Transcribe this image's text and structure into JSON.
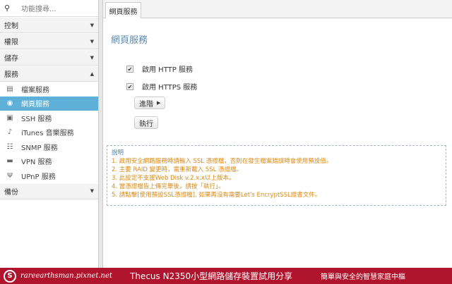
{
  "sidebar": {
    "search_placeholder": "功能搜尋...",
    "sections": [
      {
        "label": "控制"
      },
      {
        "label": "權限"
      },
      {
        "label": "儲存"
      },
      {
        "label": "服務"
      },
      {
        "label": "備份"
      }
    ],
    "items": [
      {
        "label": "檔案服務",
        "icon": "folder-icon"
      },
      {
        "label": "網頁服務",
        "icon": "globe-icon"
      },
      {
        "label": "SSH 服務",
        "icon": "terminal-icon"
      },
      {
        "label": "iTunes 音樂服務",
        "icon": "music-icon"
      },
      {
        "label": "SNMP 服務",
        "icon": "network-icon"
      },
      {
        "label": "VPN 服務",
        "icon": "vpn-icon"
      },
      {
        "label": "UPnP 服務",
        "icon": "antenna-icon"
      }
    ]
  },
  "main": {
    "tab": "網頁服務",
    "title": "網頁服務",
    "http_label": "啟用 HTTP 服務",
    "http_checked": true,
    "https_label": "啟用 HTTPS 服務",
    "https_checked": true,
    "advanced_label": "進階",
    "apply_label": "執行",
    "info": {
      "heading": "說明",
      "lines": [
        "1. 啟用安全網路服務時請輸入 SSL 憑證檔，否則在發生檔案錯誤時會使用預設值。",
        "2. 主要 RAID 變更時，需重新載入 SSL 憑證檔。",
        "3. 此設定不支援Web Disk v.2.x.x以上版本。",
        "4. 當憑證檔皆上傳完畢後，請按「執行」。",
        "5. 請點擊[使用預設SSL憑證檔], 如果再沒有需要Let's EncryptSSL證書文件。"
      ]
    }
  },
  "banner": {
    "site": "rareearthsman.pixnet.net",
    "title": "Thecus N2350小型網路儲存裝置試用分享",
    "slogan": "簡單與安全的智慧家庭中樞",
    "color": "#b0142c"
  }
}
